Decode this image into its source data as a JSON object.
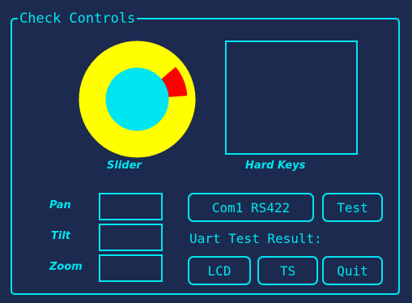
{
  "panel": {
    "title": "Check Controls"
  },
  "slider": {
    "label": "Slider",
    "level": 0.1
  },
  "hard_keys": {
    "label": "Hard Keys"
  },
  "fields": {
    "pan_label": "Pan",
    "tilt_label": "Tilt",
    "zoom_label": "Zoom"
  },
  "buttons": {
    "com": "Com1 RS422",
    "test": "Test",
    "lcd": "LCD",
    "ts": "TS",
    "quit": "Quit"
  },
  "uart": {
    "result_label": "Uart Test Result:"
  },
  "colors": {
    "background": "#1c2a4f",
    "accent": "#00e5f0",
    "dial_ring": "#ffff00",
    "dial_center": "#00e5f0",
    "dial_indicator": "#ff0000"
  }
}
